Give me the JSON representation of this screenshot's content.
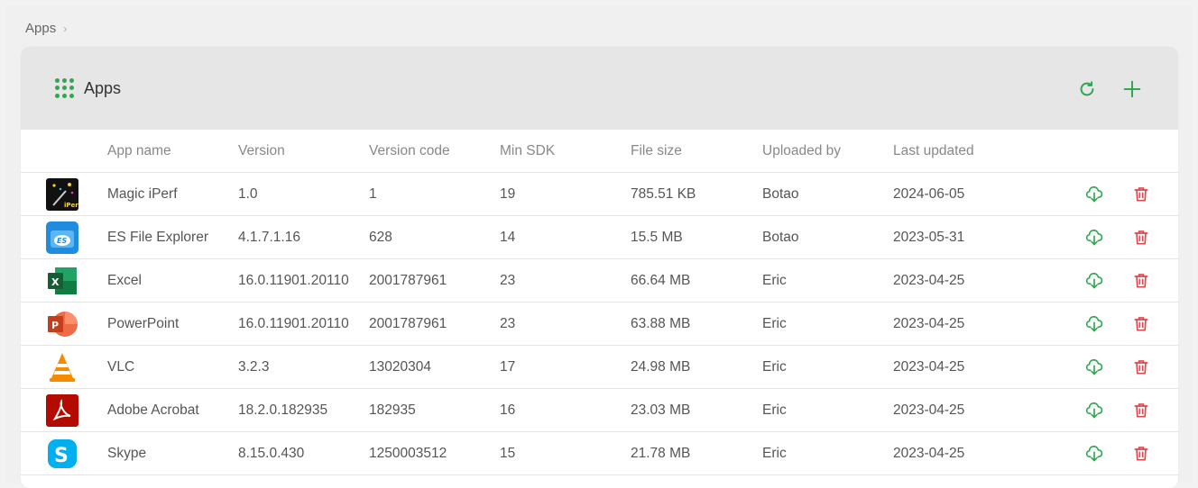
{
  "breadcrumb": {
    "root": "Apps",
    "separator": "›"
  },
  "card": {
    "title": "Apps",
    "icon": "grid-dots-icon"
  },
  "header_actions": [
    {
      "name": "refresh-button",
      "icon": "refresh-icon"
    },
    {
      "name": "add-app-button",
      "icon": "plus-icon"
    }
  ],
  "colors": {
    "accent": "#2fa84f",
    "danger": "#e0484e"
  },
  "columns": [
    "App name",
    "Version",
    "Version code",
    "Min SDK",
    "File size",
    "Uploaded by",
    "Last updated"
  ],
  "rows": [
    {
      "icon": "magic-iperf-icon",
      "name": "Magic iPerf",
      "version": "1.0",
      "code": "1",
      "sdk": "19",
      "size": "785.51 KB",
      "uploader": "Botao",
      "updated": "2024-06-05"
    },
    {
      "icon": "es-file-explorer-icon",
      "name": "ES File Explorer",
      "version": "4.1.7.1.16",
      "code": "628",
      "sdk": "14",
      "size": "15.5 MB",
      "uploader": "Botao",
      "updated": "2023-05-31"
    },
    {
      "icon": "excel-icon",
      "name": "Excel",
      "version": "16.0.11901.20110",
      "code": "2001787961",
      "sdk": "23",
      "size": "66.64 MB",
      "uploader": "Eric",
      "updated": "2023-04-25"
    },
    {
      "icon": "powerpoint-icon",
      "name": "PowerPoint",
      "version": "16.0.11901.20110",
      "code": "2001787961",
      "sdk": "23",
      "size": "63.88 MB",
      "uploader": "Eric",
      "updated": "2023-04-25"
    },
    {
      "icon": "vlc-icon",
      "name": "VLC",
      "version": "3.2.3",
      "code": "13020304",
      "sdk": "17",
      "size": "24.98 MB",
      "uploader": "Eric",
      "updated": "2023-04-25"
    },
    {
      "icon": "adobe-acrobat-icon",
      "name": "Adobe Acrobat",
      "version": "18.2.0.182935",
      "code": "182935",
      "sdk": "16",
      "size": "23.03 MB",
      "uploader": "Eric",
      "updated": "2023-04-25"
    },
    {
      "icon": "skype-icon",
      "name": "Skype",
      "version": "8.15.0.430",
      "code": "1250003512",
      "sdk": "15",
      "size": "21.78 MB",
      "uploader": "Eric",
      "updated": "2023-04-25"
    }
  ],
  "row_actions": [
    {
      "name": "download-button",
      "icon": "cloud-download-icon"
    },
    {
      "name": "delete-button",
      "icon": "trash-icon"
    }
  ]
}
